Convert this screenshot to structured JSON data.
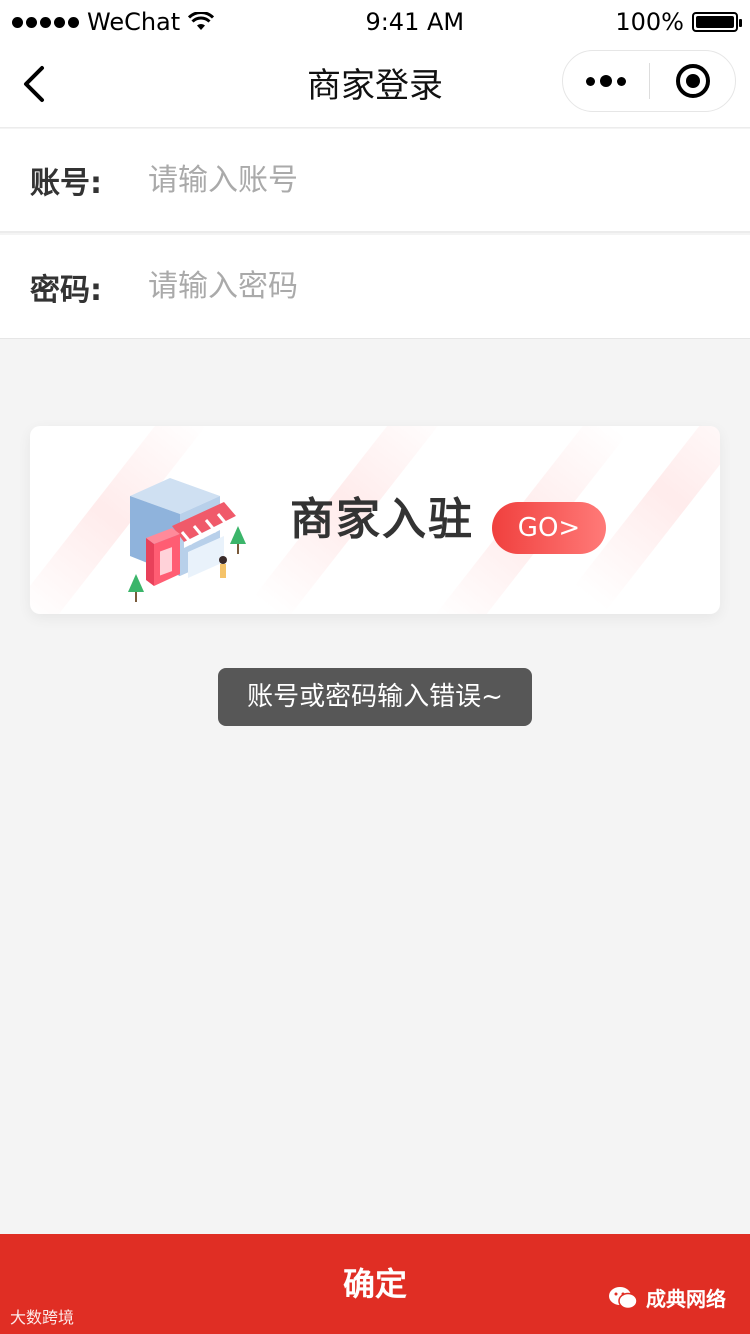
{
  "status_bar": {
    "carrier": "WeChat",
    "time": "9:41 AM",
    "battery": "100%",
    "battery_level": 1.0
  },
  "navbar": {
    "title": "商家登录"
  },
  "form": {
    "account": {
      "label": "账号:",
      "placeholder": "请输入账号",
      "value": ""
    },
    "password": {
      "label": "密码:",
      "placeholder": "请输入密码",
      "value": ""
    }
  },
  "banner": {
    "title": "商家入驻",
    "go_label": "GO>"
  },
  "toast": {
    "message": "账号或密码输入错误~"
  },
  "footer": {
    "confirm_label": "确定",
    "watermark_left": "大数跨境",
    "watermark_right": "成典网络"
  },
  "colors": {
    "accent": "#e02e24",
    "go_gradient_start": "#f0403e",
    "go_gradient_end": "#ff7a78",
    "background": "#f4f4f4"
  },
  "icons": {
    "back": "chevron-left-icon",
    "more": "more-dots-icon",
    "close": "target-circle-icon",
    "shop": "storefront-illustration",
    "wechat": "wechat-logo-icon"
  }
}
